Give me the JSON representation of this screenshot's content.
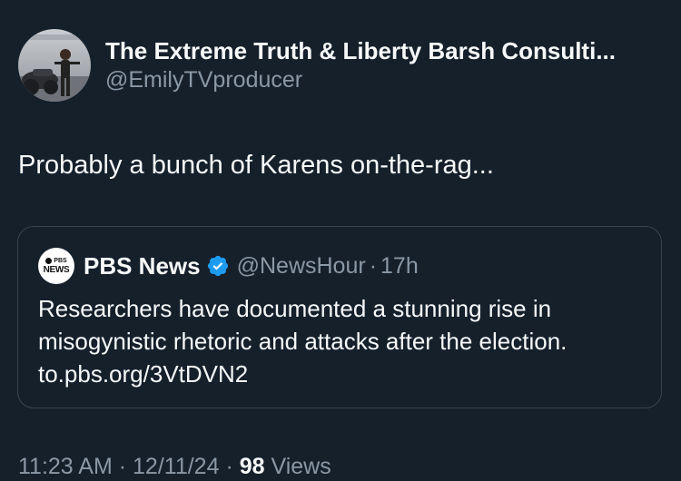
{
  "author": {
    "display_name": "The Extreme Truth & Liberty Barsh Consulti...",
    "handle": "@EmilyTVproducer",
    "avatar_icon": "profile-photo-icon"
  },
  "tweet": {
    "text": "Probably a bunch of Karens on-the-rag..."
  },
  "quoted": {
    "logo_top": "PBS",
    "logo_bottom": "NEWS",
    "name": "PBS News",
    "verified_icon": "verified-badge-icon",
    "handle": "@NewsHour",
    "separator": "·",
    "time": "17h",
    "lines": [
      "Researchers have documented a stunning rise in",
      "misogynistic rhetoric and attacks after the election.",
      "to.pbs.org/3VtDVN2"
    ]
  },
  "meta": {
    "time": "11:23 AM",
    "sep1": "·",
    "date": "12/11/24",
    "sep2": "·",
    "views_count": "98",
    "views_label": "Views"
  },
  "colors": {
    "background": "#15202b",
    "primary_text": "#f7f9f9",
    "secondary_text": "#8b98a5",
    "border": "#38444d",
    "verified_blue": "#1d9bf0"
  }
}
